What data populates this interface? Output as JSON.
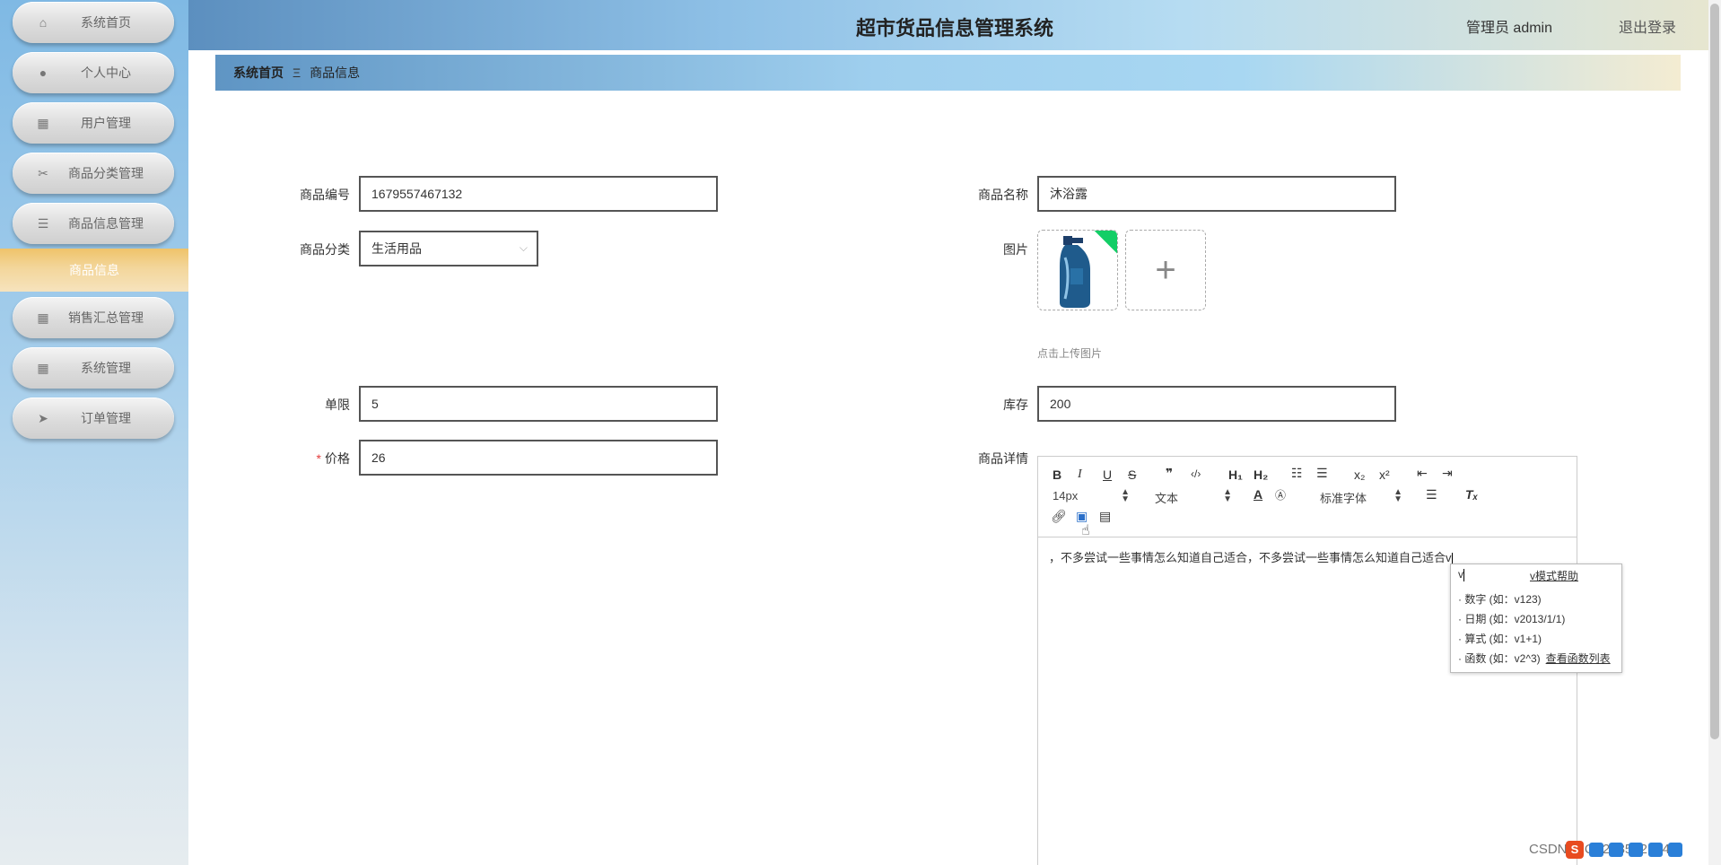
{
  "app": {
    "title": "超市货品信息管理系统",
    "user_label": "管理员 admin",
    "logout_label": "退出登录"
  },
  "sidebar": {
    "items": [
      {
        "label": "系统首页",
        "icon": "home-icon"
      },
      {
        "label": "个人中心",
        "icon": "user-icon"
      },
      {
        "label": "用户管理",
        "icon": "grid-icon"
      },
      {
        "label": "商品分类管理",
        "icon": "ticket-icon"
      },
      {
        "label": "商品信息管理",
        "icon": "list-icon"
      },
      {
        "label": "销售汇总管理",
        "icon": "grid-icon"
      },
      {
        "label": "系统管理",
        "icon": "grid-icon"
      },
      {
        "label": "订单管理",
        "icon": "send-icon"
      }
    ],
    "active_sub": "商品信息"
  },
  "breadcrumb": {
    "home": "系统首页",
    "separator": "Ξ",
    "current": "商品信息"
  },
  "form": {
    "code": {
      "label": "商品编号",
      "value": "1679557467132"
    },
    "name": {
      "label": "商品名称",
      "value": "沐浴露"
    },
    "category": {
      "label": "商品分类",
      "value": "生活用品"
    },
    "image": {
      "label": "图片",
      "hint": "点击上传图片"
    },
    "limit": {
      "label": "单限",
      "value": "5"
    },
    "stock": {
      "label": "库存",
      "value": "200"
    },
    "price": {
      "label": "价格",
      "value": "26",
      "required_mark": "*"
    },
    "detail": {
      "label": "商品详情"
    }
  },
  "editor": {
    "font_size": "14px",
    "text_type": "文本",
    "font_family": "标准字体",
    "content": "，不多尝试一些事情怎么知道自己适合，不多尝试一些事情怎么知道自己适合v"
  },
  "formula_popup": {
    "input": "v",
    "help": "v模式帮助",
    "lines": [
      "· 数字 (如：v123)",
      "· 日期 (如：v2013/1/1)",
      "· 算式 (如：v1+1)",
      "· 函数 (如：v2^3)"
    ],
    "func_link": "查看函数列表"
  },
  "watermark": "CSDN @Q3253532174"
}
